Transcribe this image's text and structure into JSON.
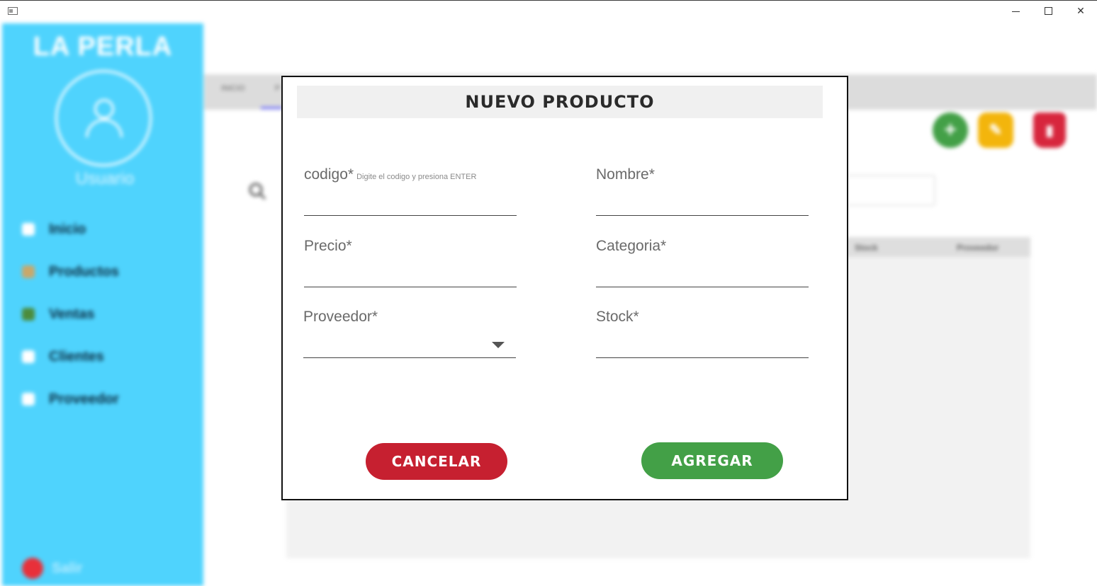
{
  "window": {
    "minimize_glyph": "",
    "maximize_glyph": "",
    "close_glyph": "✕"
  },
  "sidebar": {
    "brand": "LA PERLA",
    "user_label": "Usuario",
    "items": [
      {
        "label": "Inicio",
        "icon": "home-icon",
        "color": "#ffffff"
      },
      {
        "label": "Productos",
        "icon": "products-icon",
        "color": "#c9a86a"
      },
      {
        "label": "Ventas",
        "icon": "sales-icon",
        "color": "#4c8c3c"
      },
      {
        "label": "Clientes",
        "icon": "clients-icon",
        "color": "#ffffff"
      },
      {
        "label": "Proveedor",
        "icon": "supplier-icon",
        "color": "#ffffff"
      }
    ],
    "logout_label": "Salir"
  },
  "tabs": [
    "INICIO",
    "P"
  ],
  "table": {
    "columns": [
      "Stock",
      "Proveedor"
    ]
  },
  "dialog": {
    "title": "NUEVO PRODUCTO",
    "fields": {
      "codigo": {
        "label": "codigo*",
        "hint": "Digite el codigo y presiona ENTER",
        "value": ""
      },
      "nombre": {
        "label": "Nombre*",
        "value": ""
      },
      "precio": {
        "label": "Precio*",
        "value": ""
      },
      "categoria": {
        "label": "Categoria*",
        "value": ""
      },
      "proveedor": {
        "label": "Proveedor*",
        "value": ""
      },
      "stock": {
        "label": "Stock*",
        "value": ""
      }
    },
    "cancel_label": "CANCELAR",
    "submit_label": "AGREGAR"
  },
  "colors": {
    "sidebar": "#4fd3fd",
    "cancel": "#c62030",
    "submit": "#43a047",
    "edit": "#f3b50c",
    "delete": "#d7263d"
  }
}
